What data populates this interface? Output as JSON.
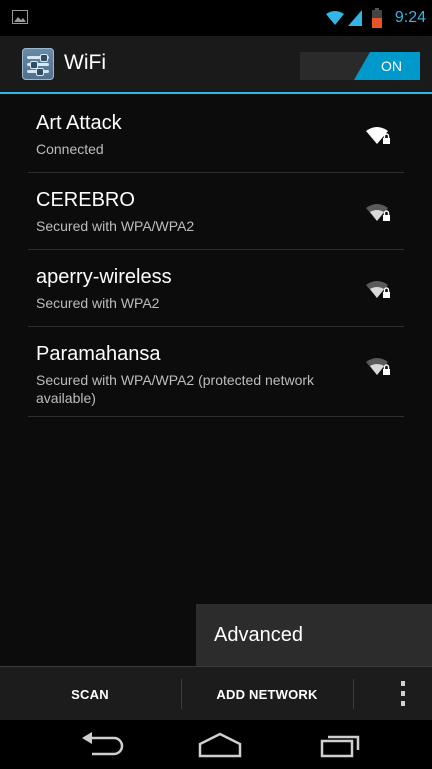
{
  "status_bar": {
    "time": "9:24",
    "icons": [
      "image-notification-icon",
      "wifi-icon",
      "signal-icon",
      "battery-icon"
    ],
    "accent": "#33b5e5",
    "battery_color": "#e8532a"
  },
  "action_bar": {
    "title": "WiFi",
    "toggle_label": "ON",
    "toggle_color": "#0099cc"
  },
  "networks": [
    {
      "name": "Art Attack",
      "status": "Connected"
    },
    {
      "name": "CEREBRO",
      "status": "Secured with WPA/WPA2"
    },
    {
      "name": "aperry-wireless",
      "status": "Secured with WPA2"
    },
    {
      "name": "Paramahansa",
      "status": "Secured with WPA/WPA2 (protected network available)"
    }
  ],
  "overflow_menu": {
    "items": [
      "Advanced"
    ]
  },
  "bottom_bar": {
    "scan_label": "SCAN",
    "add_network_label": "ADD NETWORK"
  },
  "nav_bar": {
    "icons": [
      "back-icon",
      "home-icon",
      "recent-apps-icon"
    ]
  }
}
